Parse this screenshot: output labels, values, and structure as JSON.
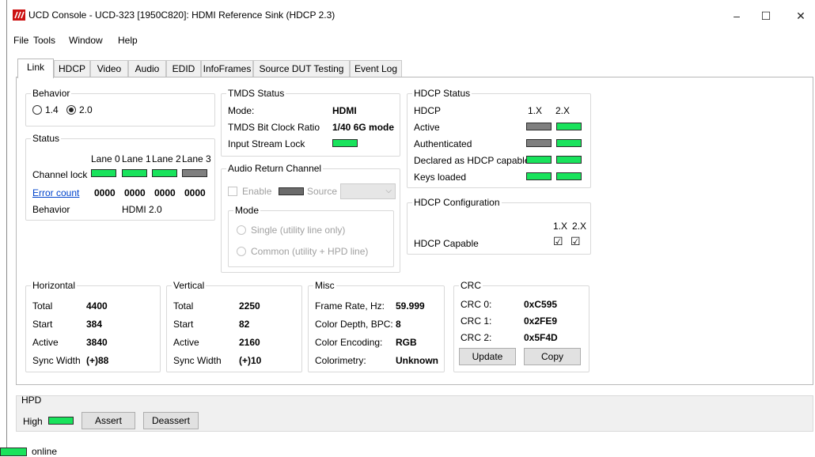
{
  "window": {
    "title": "UCD Console - UCD-323 [1950C820]: HDMI Reference Sink (HDCP 2.3)",
    "minimize": "–",
    "maximize": "☐",
    "close": "✕"
  },
  "menu": [
    {
      "label": "File"
    },
    {
      "label": "Tools"
    },
    {
      "label": "Window"
    },
    {
      "label": "Help"
    }
  ],
  "tabs": [
    "Link",
    "HDCP",
    "Video",
    "Audio",
    "EDID",
    "InfoFrames",
    "Source DUT Testing",
    "Event Log"
  ],
  "active_tab": "Link",
  "behavior": {
    "title": "Behavior",
    "option_14": "1.4",
    "option_20": "2.0",
    "selected": "2.0"
  },
  "status": {
    "title": "Status",
    "lane_headers": [
      "Lane 0",
      "Lane 1",
      "Lane 2",
      "Lane 3"
    ],
    "channel_lock_label": "Channel lock",
    "channel_lock": [
      "green",
      "green",
      "green",
      "gray"
    ],
    "error_count_label": "Error count",
    "error_counts": [
      "0000",
      "0000",
      "0000",
      "0000"
    ],
    "behavior_label": "Behavior",
    "behavior_value": "HDMI 2.0"
  },
  "tmds": {
    "title": "TMDS Status",
    "mode_label": "Mode:",
    "mode_value": "HDMI",
    "ratio_label": "TMDS Bit Clock Ratio",
    "ratio_value": "1/40 6G mode",
    "lock_label": "Input Stream Lock"
  },
  "arc": {
    "title": "Audio Return Channel",
    "enable_label": "Enable",
    "source_label": "Source",
    "mode_title": "Mode",
    "single_label": "Single  (utility line only)",
    "common_label": "Common  (utility + HPD line)"
  },
  "hdcp_status": {
    "title": "HDCP Status",
    "col_header": "HDCP",
    "v1": "1.X",
    "v2": "2.X",
    "rows": [
      {
        "label": "Active",
        "v1": "gray",
        "v2": "green"
      },
      {
        "label": "Authenticated",
        "v1": "gray",
        "v2": "green"
      },
      {
        "label": "Declared as HDCP capable",
        "v1": "green",
        "v2": "green"
      },
      {
        "label": "Keys loaded",
        "v1": "green",
        "v2": "green"
      }
    ]
  },
  "hdcp_config": {
    "title": "HDCP Configuration",
    "v1": "1.X",
    "v2": "2.X",
    "capable_label": "HDCP Capable",
    "check": "☑"
  },
  "horizontal": {
    "title": "Horizontal",
    "rows": [
      {
        "label": "Total",
        "value": "4400"
      },
      {
        "label": "Start",
        "value": "384"
      },
      {
        "label": "Active",
        "value": "3840"
      },
      {
        "label": "Sync Width",
        "value": "(+)88"
      }
    ]
  },
  "vertical": {
    "title": "Vertical",
    "rows": [
      {
        "label": "Total",
        "value": "2250"
      },
      {
        "label": "Start",
        "value": "82"
      },
      {
        "label": "Active",
        "value": "2160"
      },
      {
        "label": "Sync Width",
        "value": "(+)10"
      }
    ]
  },
  "misc": {
    "title": "Misc",
    "rows": [
      {
        "label": "Frame Rate, Hz:",
        "value": "59.999"
      },
      {
        "label": "Color Depth, BPC:",
        "value": "8"
      },
      {
        "label": "Color Encoding:",
        "value": "RGB"
      },
      {
        "label": "Colorimetry:",
        "value": "Unknown"
      }
    ]
  },
  "crc": {
    "title": "CRC",
    "rows": [
      {
        "label": "CRC 0:",
        "value": "0xC595"
      },
      {
        "label": "CRC 1:",
        "value": "0x2FE9"
      },
      {
        "label": "CRC 2:",
        "value": "0x5F4D"
      }
    ],
    "update_label": "Update",
    "copy_label": "Copy"
  },
  "hpd": {
    "title": "HPD",
    "high_label": "High",
    "assert_label": "Assert",
    "deassert_label": "Deassert"
  },
  "statusbar": {
    "status_text": "online"
  },
  "colors": {
    "led_green": "#19e35c",
    "led_gray": "#7f7f7f",
    "link_blue": "#0044cc",
    "app_icon_red": "#cc1111"
  }
}
